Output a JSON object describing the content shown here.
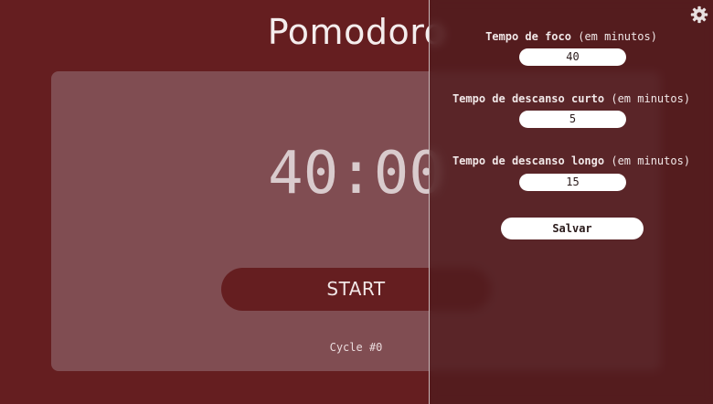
{
  "app": {
    "title": "Pomodoro"
  },
  "timer": {
    "display": "40:00",
    "start_label": "START",
    "cycle_label": "Cycle #0"
  },
  "settings": {
    "focus": {
      "label": "Tempo de foco",
      "unit": "(em minutos)",
      "value": "40"
    },
    "short_break": {
      "label": "Tempo de descanso curto",
      "unit": "(em minutos)",
      "value": "5"
    },
    "long_break": {
      "label": "Tempo de descanso longo",
      "unit": "(em minutos)",
      "value": "15"
    },
    "save_label": "Salvar"
  },
  "icons": {
    "settings": "gear-icon"
  },
  "colors": {
    "background": "#651e20",
    "card": "#804d52",
    "panel": "#501c1e",
    "text_light": "#f4eded"
  }
}
